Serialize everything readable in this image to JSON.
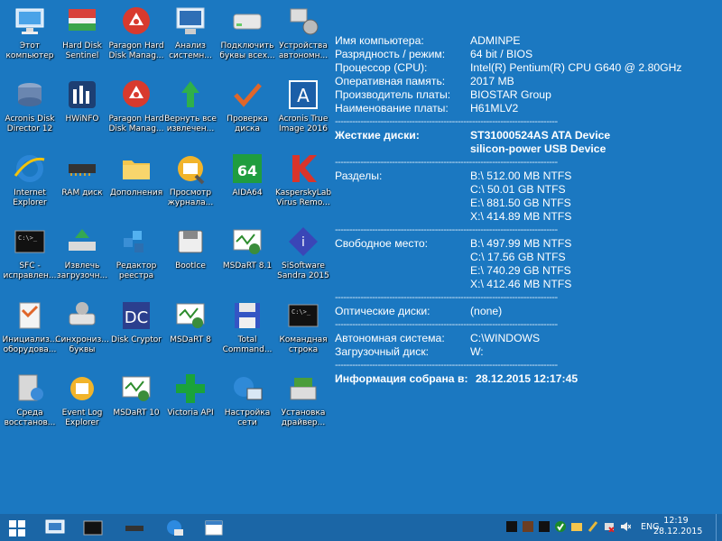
{
  "desktop": {
    "icons": [
      {
        "label": "Этот\nкомпьютер",
        "icon": "computer-icon"
      },
      {
        "label": "Hard Disk\nSentinel",
        "icon": "hard-disk-sentinel-icon"
      },
      {
        "label": "Paragon Hard\nDisk Manag...",
        "icon": "paragon-icon"
      },
      {
        "label": "Анализ\nсистемн...",
        "icon": "system-analysis-icon"
      },
      {
        "label": "Подключить\nбуквы всех...",
        "icon": "drive-letters-icon"
      },
      {
        "label": "Устройства\nавтономн...",
        "icon": "devices-icon"
      },
      {
        "label": "Acronis Disk\nDirector 12",
        "icon": "acronis-disk-icon"
      },
      {
        "label": "HWiNFO",
        "icon": "hwinfo-icon"
      },
      {
        "label": "Paragon Hard\nDisk Manag...",
        "icon": "paragon-icon"
      },
      {
        "label": "Вернуть все\nизвлечен...",
        "icon": "green-arrow-icon"
      },
      {
        "label": "Проверка\nдиска",
        "icon": "checkmark-icon"
      },
      {
        "label": "Acronis True\nImage 2016",
        "icon": "acronis-true-image-icon"
      },
      {
        "label": "Internet\nExplorer",
        "icon": "internet-explorer-icon"
      },
      {
        "label": "RAM диск",
        "icon": "ram-chip-icon"
      },
      {
        "label": "Дополнения",
        "icon": "folder-icon"
      },
      {
        "label": "Просмотр\nжурнала...",
        "icon": "event-viewer-icon"
      },
      {
        "label": "AIDA64",
        "icon": "aida64-icon"
      },
      {
        "label": "KasperskyLab\nVirus Remo...",
        "icon": "kaspersky-icon"
      },
      {
        "label": "SFC -\nисправлен...",
        "icon": "console-icon"
      },
      {
        "label": "Извлечь\nзагрузочн...",
        "icon": "eject-boot-icon"
      },
      {
        "label": "Редактор\nреестра",
        "icon": "registry-editor-icon"
      },
      {
        "label": "BootIce",
        "icon": "bootice-icon"
      },
      {
        "label": "MSDaRT 8.1",
        "icon": "msdart-icon"
      },
      {
        "label": "SiSoftware\nSandra 2015",
        "icon": "sandra-icon"
      },
      {
        "label": "Инициализ...\nоборудова...",
        "icon": "hardware-init-icon"
      },
      {
        "label": "Синхрониз...\nбуквы носи...",
        "icon": "sync-drives-icon"
      },
      {
        "label": "Disk Cryptor",
        "icon": "diskcryptor-icon"
      },
      {
        "label": "MSDaRT 8",
        "icon": "msdart-icon"
      },
      {
        "label": "Total\nCommand...",
        "icon": "total-commander-icon"
      },
      {
        "label": "Командная\nстрока",
        "icon": "command-prompt-icon"
      },
      {
        "label": "Среда\nвосстанов...",
        "icon": "recovery-env-icon"
      },
      {
        "label": "Event Log\nExplorer",
        "icon": "event-log-explorer-icon"
      },
      {
        "label": "MSDaRT 10",
        "icon": "msdart-icon"
      },
      {
        "label": "Victoria API",
        "icon": "victoria-icon"
      },
      {
        "label": "Настройка\nсети",
        "icon": "network-settings-icon"
      },
      {
        "label": "Установка\nдрайвер...",
        "icon": "driver-install-icon"
      }
    ]
  },
  "sysinfo": {
    "computer_name": {
      "label": "Имя компьютера:",
      "value": "ADMINPE"
    },
    "bitness": {
      "label": "Разрядность / режим:",
      "value": "64 bit / BIOS"
    },
    "cpu": {
      "label": "Процессор (CPU):",
      "value": "Intel(R) Pentium(R) CPU G640 @ 2.80GHz"
    },
    "ram": {
      "label": "Оперативная память:",
      "value": "2017 MB"
    },
    "board_maker": {
      "label": "Производитель платы:",
      "value": "BIOSTAR Group"
    },
    "board_name": {
      "label": "Наименование платы:",
      "value": "H61MLV2"
    },
    "separator": "------------------------------------------------------------------------------",
    "disks": {
      "label": "Жесткие диски:",
      "values": [
        "ST31000524AS ATA Device",
        "silicon-power USB Device"
      ]
    },
    "partitions": {
      "label": "Разделы:",
      "values": [
        "B:\\ 512.00 MB NTFS",
        "C:\\ 50.01 GB NTFS",
        "E:\\ 881.50 GB NTFS",
        "X:\\ 414.89 MB NTFS"
      ]
    },
    "free_space": {
      "label": "Свободное место:",
      "values": [
        "B:\\ 497.99 MB NTFS",
        "C:\\ 17.56 GB NTFS",
        "E:\\ 740.29 GB NTFS",
        "X:\\ 412.46 MB NTFS"
      ]
    },
    "optical": {
      "label": "Оптические диски:",
      "value": "(none)"
    },
    "offline_system": {
      "label": "Автономная система:",
      "value": "C:\\WINDOWS"
    },
    "boot_disk": {
      "label": "Загрузочный диск:",
      "value": "W:"
    },
    "collected": {
      "label": "Информация собрана в:",
      "value": "28.12.2015 12:17:45"
    }
  },
  "taskbar": {
    "pinned": [
      "windows-start-icon",
      "display-icon",
      "console-icon",
      "ram-chip-icon",
      "network-globe-icon",
      "window-icon"
    ],
    "tray": [
      "black-square-icon",
      "brown-square-icon",
      "black-square-icon",
      "green-check-icon",
      "folder-icon",
      "brush-icon",
      "network-error-icon",
      "speaker-mute-icon"
    ],
    "language": "ENG",
    "time": "12:19",
    "date": "28.12.2015"
  }
}
